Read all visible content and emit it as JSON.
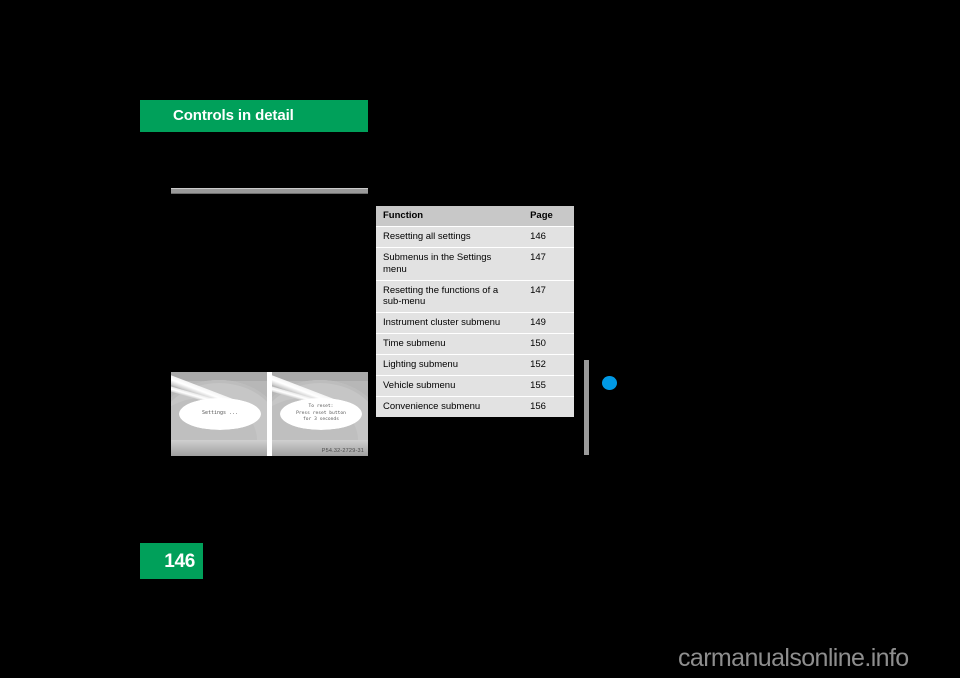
{
  "document": {
    "chapter_header": "Controls in detail",
    "page_number": "146",
    "watermark": "carmanualsonline.info"
  },
  "reference_table": {
    "columns": [
      "Function",
      "Page"
    ],
    "rows": [
      {
        "function": "Resetting all settings",
        "page": "146"
      },
      {
        "function": "Submenus in the Settings menu",
        "page": "147"
      },
      {
        "function": "Resetting the functions of a sub-menu",
        "page": "147"
      },
      {
        "function": "Instrument cluster submenu",
        "page": "149"
      },
      {
        "function": "Time submenu",
        "page": "150"
      },
      {
        "function": "Lighting submenu",
        "page": "152"
      },
      {
        "function": "Vehicle submenu",
        "page": "155"
      },
      {
        "function": "Convenience submenu",
        "page": "156"
      }
    ]
  },
  "figure": {
    "caption": "P54.32-2729-31",
    "panels": [
      {
        "display_text": "Settings ..."
      },
      {
        "display_text": "To reset:\nPress reset button\nfor 3 seconds"
      }
    ]
  },
  "margin_marks": {
    "dot_color": "#0099E5",
    "bar_color": "#9b9b9b"
  },
  "colors": {
    "brand_green": "#00A05A",
    "table_row": "#e2e2e2",
    "table_header": "#c8c8c8"
  }
}
